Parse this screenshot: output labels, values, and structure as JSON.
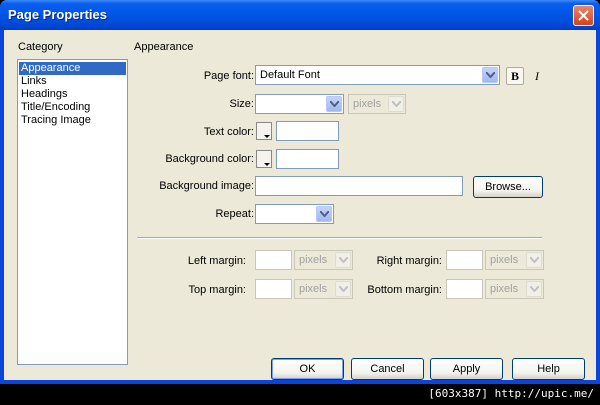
{
  "window": {
    "title": "Page Properties"
  },
  "category": {
    "label": "Category",
    "items": [
      "Appearance",
      "Links",
      "Headings",
      "Title/Encoding",
      "Tracing Image"
    ],
    "selected": "Appearance"
  },
  "section": {
    "title": "Appearance"
  },
  "fields": {
    "page_font_label": "Page font:",
    "page_font_value": "Default Font",
    "bold_label": "B",
    "italic_label": "I",
    "size_label": "Size:",
    "size_value": "",
    "size_unit": "pixels",
    "text_color_label": "Text color:",
    "text_color_value": "",
    "bg_color_label": "Background color:",
    "bg_color_value": "",
    "bg_image_label": "Background image:",
    "bg_image_value": "",
    "browse_label": "Browse...",
    "repeat_label": "Repeat:",
    "repeat_value": ""
  },
  "margins": {
    "left_label": "Left margin:",
    "right_label": "Right margin:",
    "top_label": "Top margin:",
    "bottom_label": "Bottom margin:",
    "unit": "pixels"
  },
  "buttons": {
    "ok": "OK",
    "cancel": "Cancel",
    "apply": "Apply",
    "help": "Help"
  },
  "footer": {
    "text": "[603x387] http://upic.me/"
  },
  "colors": {
    "titlebar": "#0055e5",
    "selection": "#316ac5",
    "dialog_bg": "#ece9d8",
    "close": "#d2421c"
  }
}
